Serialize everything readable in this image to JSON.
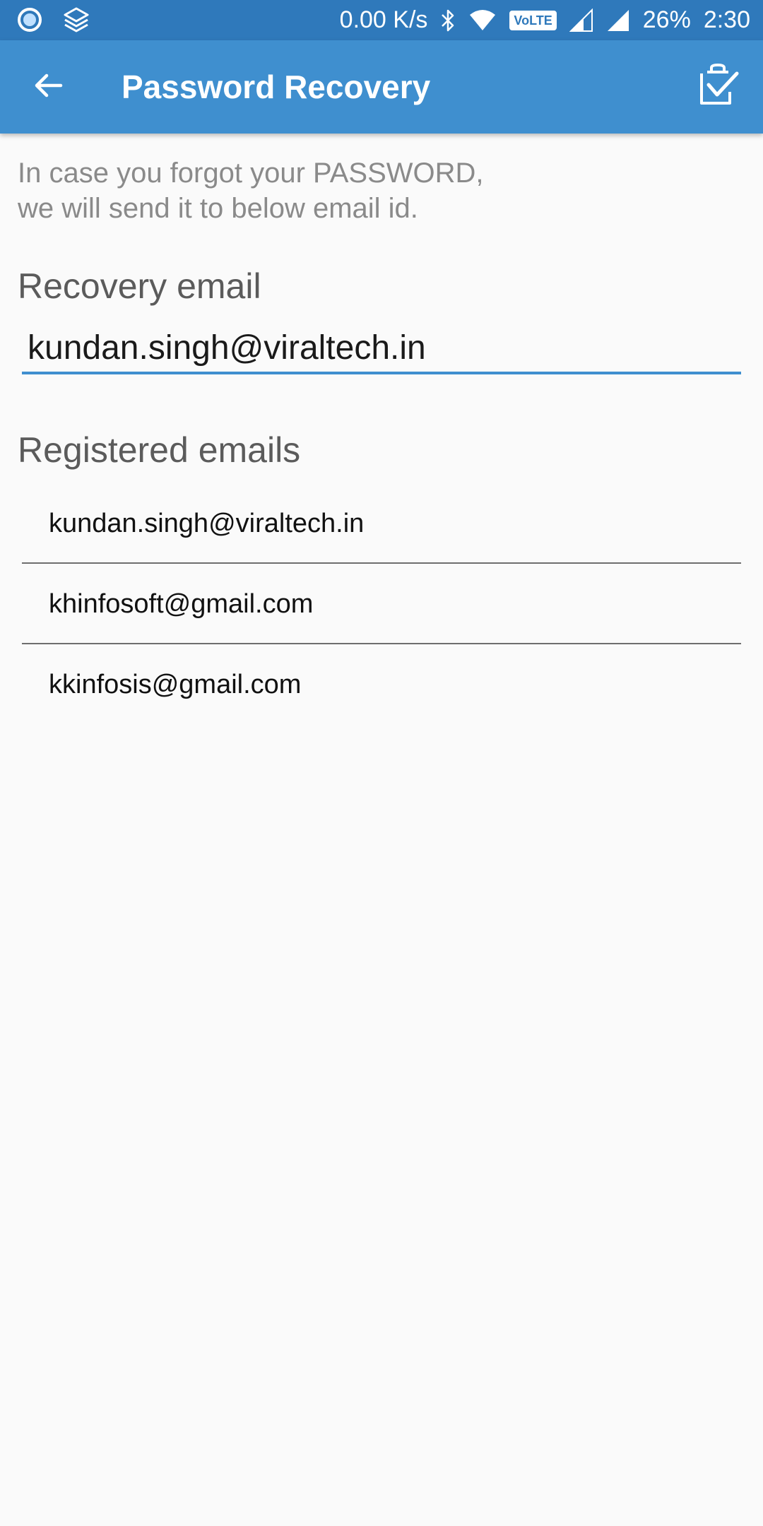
{
  "status_bar": {
    "net_speed": "0.00 K/s",
    "network_badge": "VoLTE",
    "battery": "26%",
    "time": "2:30",
    "icons": [
      "circle-app-icon",
      "layers-icon",
      "bluetooth-icon",
      "wifi-icon",
      "signal-r-icon",
      "signal-icon"
    ]
  },
  "app_bar": {
    "title": "Password Recovery",
    "back_icon": "arrow-left-icon",
    "action_icon": "clipboard-check-icon",
    "color": "#3f8fcf"
  },
  "info": {
    "line1": "In case you forgot your PASSWORD,",
    "line2": "we will send it to below email id."
  },
  "recovery": {
    "label": "Recovery email",
    "value": "kundan.singh@viraltech.in"
  },
  "registered": {
    "label": "Registered emails",
    "emails": [
      "kundan.singh@viraltech.in",
      "khinfosoft@gmail.com",
      "kkinfosis@gmail.com"
    ]
  }
}
